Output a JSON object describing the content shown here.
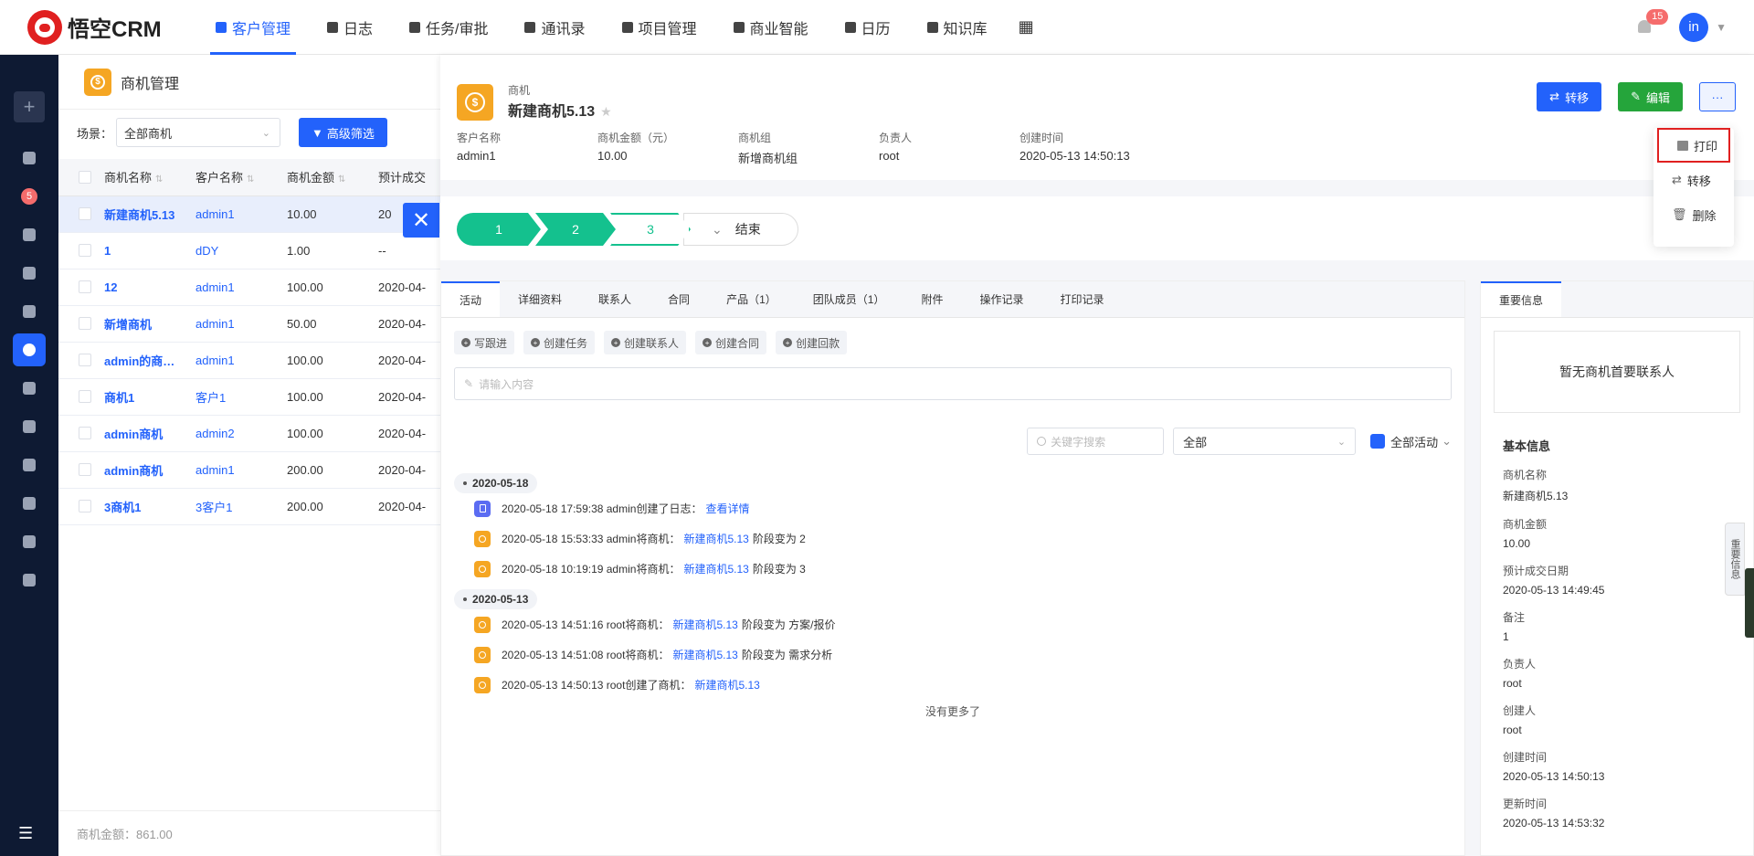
{
  "app": {
    "name": "悟空CRM"
  },
  "nav": [
    {
      "label": "客户管理",
      "active": true
    },
    {
      "label": "日志"
    },
    {
      "label": "任务/审批"
    },
    {
      "label": "通讯录"
    },
    {
      "label": "项目管理"
    },
    {
      "label": "商业智能"
    },
    {
      "label": "日历"
    },
    {
      "label": "知识库"
    }
  ],
  "user": {
    "notifications": "15",
    "avatar": "in"
  },
  "sidebar": {
    "badge": "5"
  },
  "list": {
    "title": "商机管理",
    "scene_label": "场景：",
    "scene_value": "全部商机",
    "filter_button": "高级筛选",
    "columns": [
      "商机名称",
      "客户名称",
      "商机金额",
      "预计成交"
    ],
    "rows": [
      {
        "name": "新建商机5.13",
        "customer": "admin1",
        "amount": "10.00",
        "date": "20"
      },
      {
        "name": "1",
        "customer": "dDY",
        "amount": "1.00",
        "date": "--"
      },
      {
        "name": "12",
        "customer": "admin1",
        "amount": "100.00",
        "date": "2020-04-"
      },
      {
        "name": "新增商机",
        "customer": "admin1",
        "amount": "50.00",
        "date": "2020-04-"
      },
      {
        "name": "admin的商…",
        "customer": "admin1",
        "amount": "100.00",
        "date": "2020-04-"
      },
      {
        "name": "商机1",
        "customer": "客户1",
        "amount": "100.00",
        "date": "2020-04-"
      },
      {
        "name": "admin商机",
        "customer": "admin2",
        "amount": "100.00",
        "date": "2020-04-"
      },
      {
        "name": "admin商机",
        "customer": "admin1",
        "amount": "200.00",
        "date": "2020-04-"
      },
      {
        "name": "3商机1",
        "customer": "3客户1",
        "amount": "200.00",
        "date": "2020-04-"
      }
    ],
    "footer": "商机金额：861.00"
  },
  "detail": {
    "type": "商机",
    "name": "新建商机5.13",
    "transfer_btn": "转移",
    "edit_btn": "编辑",
    "more_btn": "···",
    "fields": [
      {
        "k": "客户名称",
        "v": "admin1"
      },
      {
        "k": "商机金额（元）",
        "v": "10.00"
      },
      {
        "k": "商机组",
        "v": "新增商机组"
      },
      {
        "k": "负责人",
        "v": "root"
      },
      {
        "k": "创建时间",
        "v": "2020-05-13 14:50:13"
      }
    ],
    "dropdown": [
      "打印",
      "转移",
      "删除"
    ],
    "stages": [
      "1",
      "2",
      "3"
    ],
    "stage_end": "结束",
    "tabs": [
      "活动",
      "详细资料",
      "联系人",
      "合同",
      "产品（1）",
      "团队成员（1）",
      "附件",
      "操作记录",
      "打印记录"
    ],
    "actions": [
      "写跟进",
      "创建任务",
      "创建联系人",
      "创建合同",
      "创建回款"
    ],
    "input_placeholder": "请输入内容",
    "search_placeholder": "关键字搜索",
    "filter_value": "全部",
    "all_activity": "全部活动",
    "groups": [
      {
        "date": "2020-05-18",
        "items": [
          {
            "icon": "log",
            "text": "2020-05-18 17:59:38 admin创建了日志：",
            "link": "查看详情",
            "tail": ""
          },
          {
            "icon": "opp",
            "text": "2020-05-18 15:53:33 admin将商机：",
            "link": "新建商机5.13",
            "tail": "阶段变为 2"
          },
          {
            "icon": "opp",
            "text": "2020-05-18 10:19:19 admin将商机：",
            "link": "新建商机5.13",
            "tail": "阶段变为 3"
          }
        ]
      },
      {
        "date": "2020-05-13",
        "items": [
          {
            "icon": "opp",
            "text": "2020-05-13 14:51:16 root将商机：",
            "link": "新建商机5.13",
            "tail": "阶段变为 方案/报价"
          },
          {
            "icon": "opp",
            "text": "2020-05-13 14:51:08 root将商机：",
            "link": "新建商机5.13",
            "tail": "阶段变为 需求分析"
          },
          {
            "icon": "opp",
            "text": "2020-05-13 14:50:13 root创建了商机：",
            "link": "新建商机5.13",
            "tail": ""
          }
        ]
      }
    ],
    "no_more": "没有更多了",
    "side_tab": "重要信息",
    "no_contact": "暂无商机首要联系人",
    "basic_title": "基本信息",
    "basic": [
      {
        "k": "商机名称",
        "v": "新建商机5.13"
      },
      {
        "k": "商机金额",
        "v": "10.00"
      },
      {
        "k": "预计成交日期",
        "v": "2020-05-13 14:49:45"
      },
      {
        "k": "备注",
        "v": "1"
      },
      {
        "k": "负责人",
        "v": "root"
      },
      {
        "k": "创建人",
        "v": "root"
      },
      {
        "k": "创建时间",
        "v": "2020-05-13 14:50:13"
      },
      {
        "k": "更新时间",
        "v": "2020-05-13 14:53:32"
      }
    ],
    "side_flag": "重要信息"
  }
}
